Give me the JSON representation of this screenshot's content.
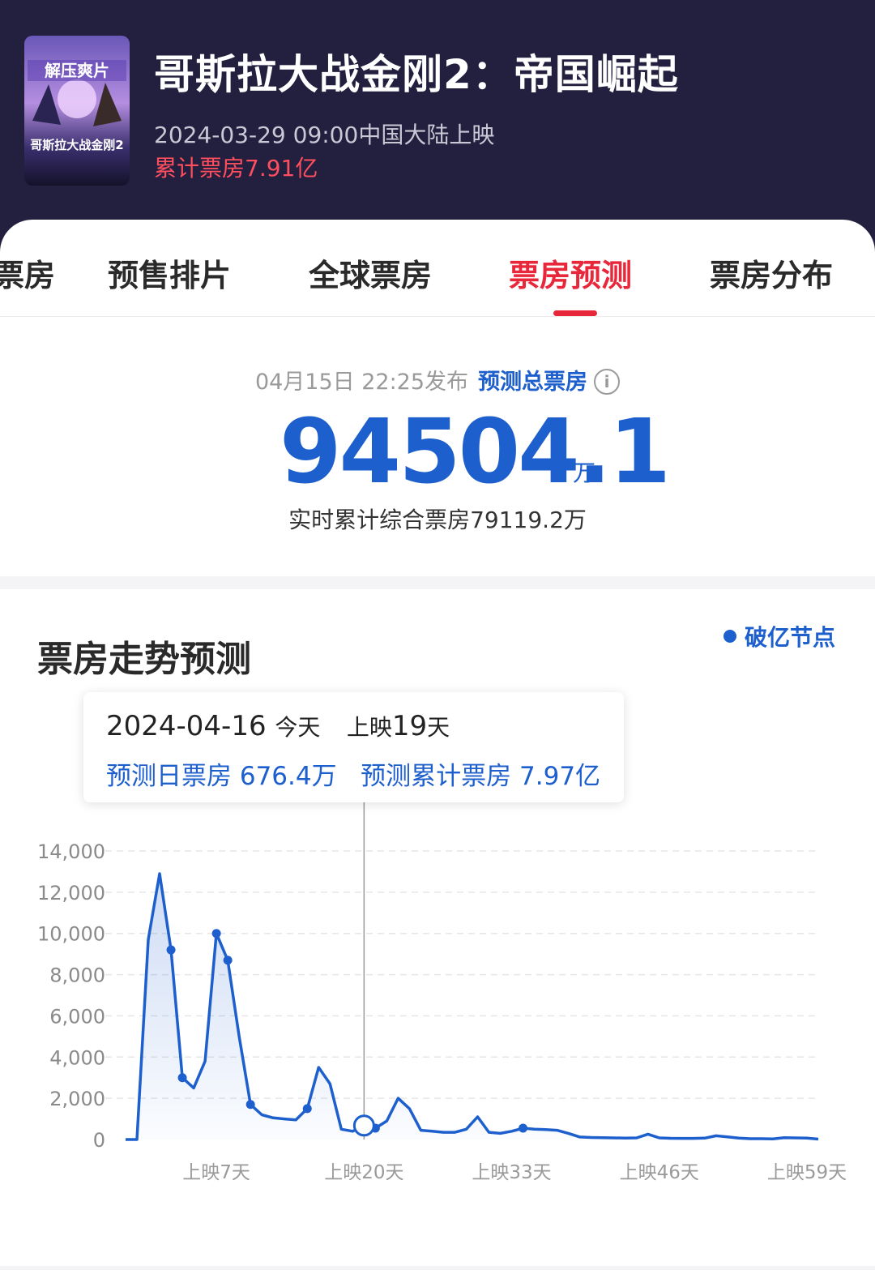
{
  "movie": {
    "poster_banner": "解压爽片",
    "poster_title": "哥斯拉大战金刚2",
    "title": "哥斯拉大战金刚2：帝国崛起",
    "release": "2024-03-29 09:00中国大陆上映",
    "cumulative": "累计票房7.91亿"
  },
  "tabs": [
    {
      "label": "票房"
    },
    {
      "label": "预售排片"
    },
    {
      "label": "全球票房"
    },
    {
      "label": "票房预测"
    },
    {
      "label": "票房分布"
    }
  ],
  "forecast": {
    "published": "04月15日 22:25发布",
    "label": "预测总票房",
    "info_icon": "i",
    "total": "94504.1",
    "unit": "万",
    "realtime": "实时累计综合票房79119.2万"
  },
  "trend": {
    "title": "票房走势预测",
    "legend": "破亿节点",
    "tooltip": {
      "date": "2024-04-16",
      "today": "今天",
      "days_label": "上映",
      "days": "19",
      "days_unit": "天",
      "daily": "预测日票房 676.4万",
      "cumulative": "预测累计票房 7.97亿"
    }
  },
  "colors": {
    "accent": "#e8283a",
    "blue": "#1e5fce",
    "header_bg": "#221f3f"
  },
  "chart_data": {
    "type": "area",
    "x_unit": "上映天数",
    "yticks": [
      "14,000",
      "12,000",
      "10,000",
      "8,000",
      "6,000",
      "4,000",
      "2,000",
      "0"
    ],
    "ylim": [
      0,
      14000
    ],
    "xtick_labels": [
      "上映7天",
      "上映20天",
      "上映33天",
      "上映46天",
      "上映59天"
    ],
    "xtick_days": [
      7,
      20,
      33,
      46,
      59
    ],
    "x": [
      -1,
      0,
      1,
      2,
      3,
      4,
      5,
      6,
      7,
      8,
      9,
      10,
      11,
      12,
      13,
      14,
      15,
      16,
      17,
      18,
      19,
      20,
      21,
      22,
      23,
      24,
      25,
      26,
      27,
      28,
      29,
      30,
      31,
      32,
      33,
      34,
      35,
      36,
      37,
      38,
      39,
      40,
      41,
      42,
      43,
      44,
      45,
      46,
      47,
      48,
      49,
      50,
      51,
      52,
      53,
      54,
      55,
      56,
      57,
      58,
      59,
      60
    ],
    "values": [
      0,
      0,
      9700,
      12900,
      9200,
      3000,
      2500,
      3800,
      10000,
      8700,
      5000,
      1700,
      1200,
      1050,
      1000,
      950,
      1500,
      3500,
      2700,
      500,
      400,
      676,
      550,
      900,
      2000,
      1500,
      450,
      400,
      350,
      350,
      500,
      1100,
      350,
      300,
      400,
      550,
      500,
      480,
      450,
      300,
      120,
      100,
      90,
      80,
      70,
      80,
      260,
      80,
      60,
      55,
      55,
      65,
      180,
      130,
      70,
      40,
      40,
      30,
      90,
      80,
      70,
      20
    ],
    "markers_x": [
      3,
      4,
      7,
      8,
      10,
      15,
      21,
      34
    ],
    "current_x": 20
  }
}
